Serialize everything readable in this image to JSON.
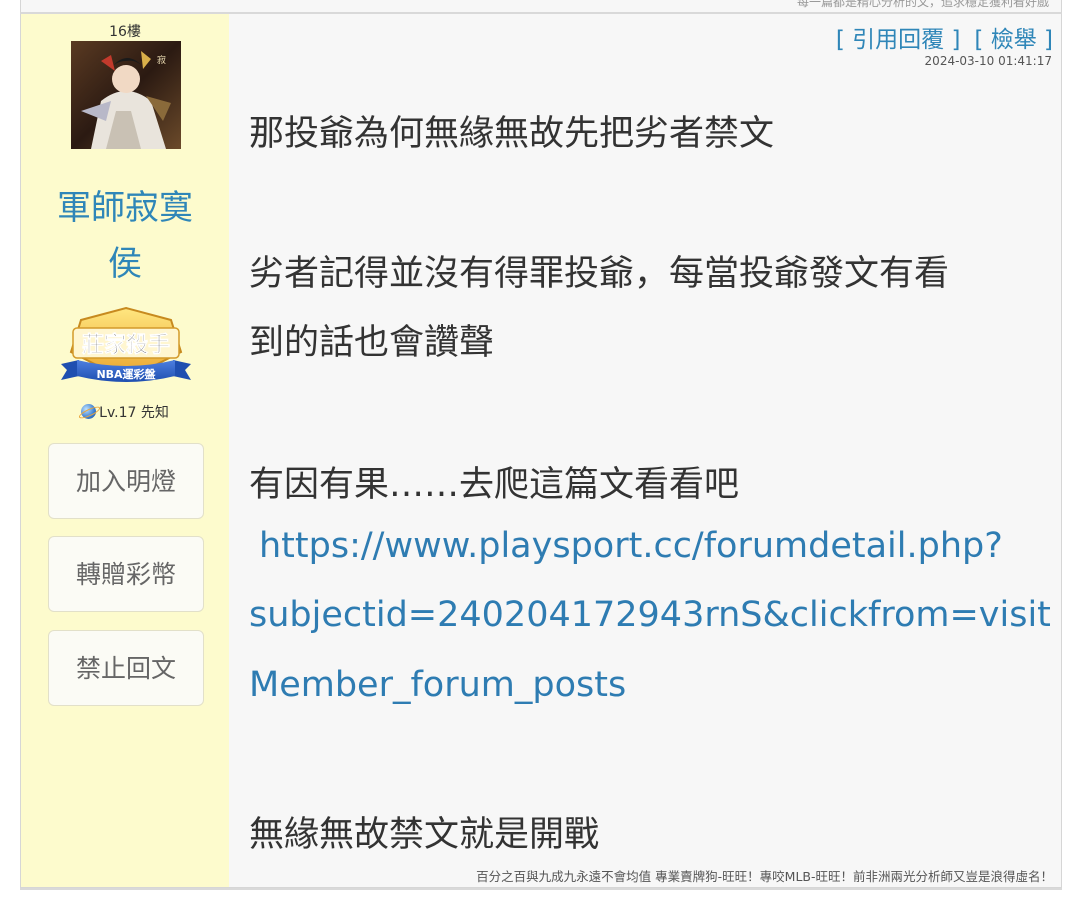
{
  "top_strip_text": "每一篇都是精心分析的文，追求穩定獲利看好戲",
  "post": {
    "floor_label": "16樓",
    "username": "軍師寂寞侯",
    "username_line1": "軍師寂寞",
    "username_line2": "侯",
    "badge": {
      "title": "莊家殺手",
      "subtitle": "NBA運彩盤"
    },
    "level_text": "Lv.17 先知",
    "sidebar_buttons": {
      "add_light": "加入明燈",
      "transfer_coins": "轉贈彩幣",
      "ban_reply": "禁止回文"
    },
    "actions": {
      "quote_reply": "[ 引用回覆 ]",
      "report": "[ 檢舉 ]"
    },
    "timestamp": "2024-03-10 01:41:17",
    "body": {
      "p1": "那投爺為何無緣無故先把劣者禁文",
      "p2_line1": "劣者記得並沒有得罪投爺，每當投爺發文有看",
      "p2_line2": "到的話也會讚聲",
      "p3": "有因有果……去爬這篇文看看吧",
      "link_line1": "https://www.playsport.cc/forumdetail.php?",
      "link_line2": "subjectid=240204172943rnS&clickfrom=visit",
      "link_line3": "Member_forum_posts",
      "p4": "無緣無故禁文就是開戰"
    },
    "signature": "百分之百與九成九永遠不會均值 專業賣牌狗-旺旺！專咬MLB-旺旺！前非洲兩光分析師又豈是浪得虛名！"
  },
  "colors": {
    "sidebar_bg": "#fdfbcd",
    "post_bg": "#f7f7f7",
    "link": "#2f86b8",
    "text": "#333333"
  }
}
